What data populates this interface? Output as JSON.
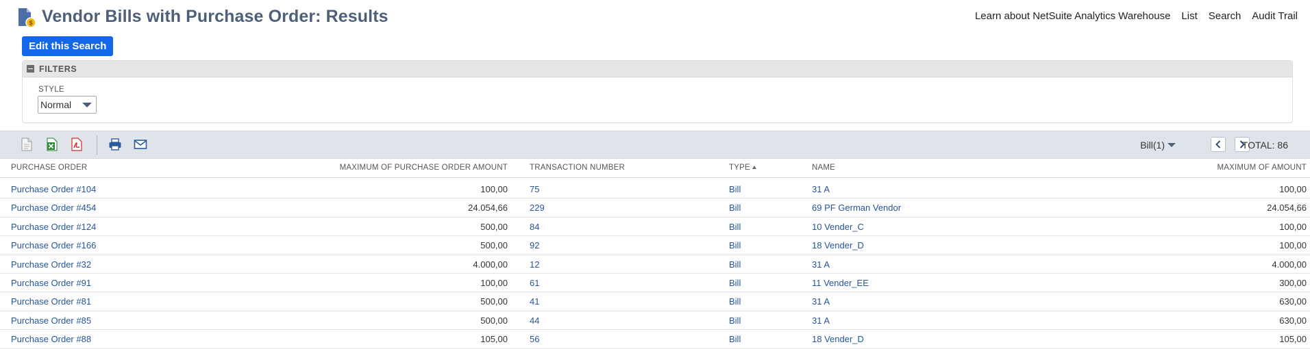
{
  "header": {
    "title": "Vendor Bills with Purchase Order: Results",
    "links": [
      "Learn about NetSuite Analytics Warehouse",
      "List",
      "Search",
      "Audit Trail"
    ]
  },
  "edit_button": "Edit this Search",
  "filters": {
    "title": "FILTERS",
    "style_label": "STYLE",
    "style_value": "Normal"
  },
  "toolbar": {
    "icons": [
      "export-csv-icon",
      "export-excel-icon",
      "export-pdf-icon",
      "print-icon",
      "email-icon"
    ],
    "bill_selector": "Bill(1)",
    "total": "TOTAL: 86"
  },
  "table": {
    "columns": [
      "PURCHASE ORDER",
      "MAXIMUM OF PURCHASE ORDER AMOUNT",
      "TRANSACTION NUMBER",
      "TYPE",
      "NAME",
      "MAXIMUM OF AMOUNT"
    ],
    "rows": [
      {
        "po": "Purchase Order #104",
        "max_po": "100,00",
        "tran": "75",
        "type": "Bill",
        "name": "31 A",
        "amount": "100,00"
      },
      {
        "po": "Purchase Order #454",
        "max_po": "24.054,66",
        "tran": "229",
        "type": "Bill",
        "name": "69 PF German Vendor",
        "amount": "24.054,66"
      },
      {
        "po": "Purchase Order #124",
        "max_po": "500,00",
        "tran": "84",
        "type": "Bill",
        "name": "10 Vender_C",
        "amount": "100,00"
      },
      {
        "po": "Purchase Order #166",
        "max_po": "500,00",
        "tran": "92",
        "type": "Bill",
        "name": "18 Vender_D",
        "amount": "100,00"
      },
      {
        "po": "Purchase Order #32",
        "max_po": "4.000,00",
        "tran": "12",
        "type": "Bill",
        "name": "31 A",
        "amount": "4.000,00"
      },
      {
        "po": "Purchase Order #91",
        "max_po": "100,00",
        "tran": "61",
        "type": "Bill",
        "name": "11 Vender_EE",
        "amount": "300,00"
      },
      {
        "po": "Purchase Order #81",
        "max_po": "500,00",
        "tran": "41",
        "type": "Bill",
        "name": "31 A",
        "amount": "630,00"
      },
      {
        "po": "Purchase Order #85",
        "max_po": "500,00",
        "tran": "44",
        "type": "Bill",
        "name": "31 A",
        "amount": "630,00"
      },
      {
        "po": "Purchase Order #88",
        "max_po": "105,00",
        "tran": "56",
        "type": "Bill",
        "name": "18 Vender_D",
        "amount": "105,00"
      }
    ]
  }
}
